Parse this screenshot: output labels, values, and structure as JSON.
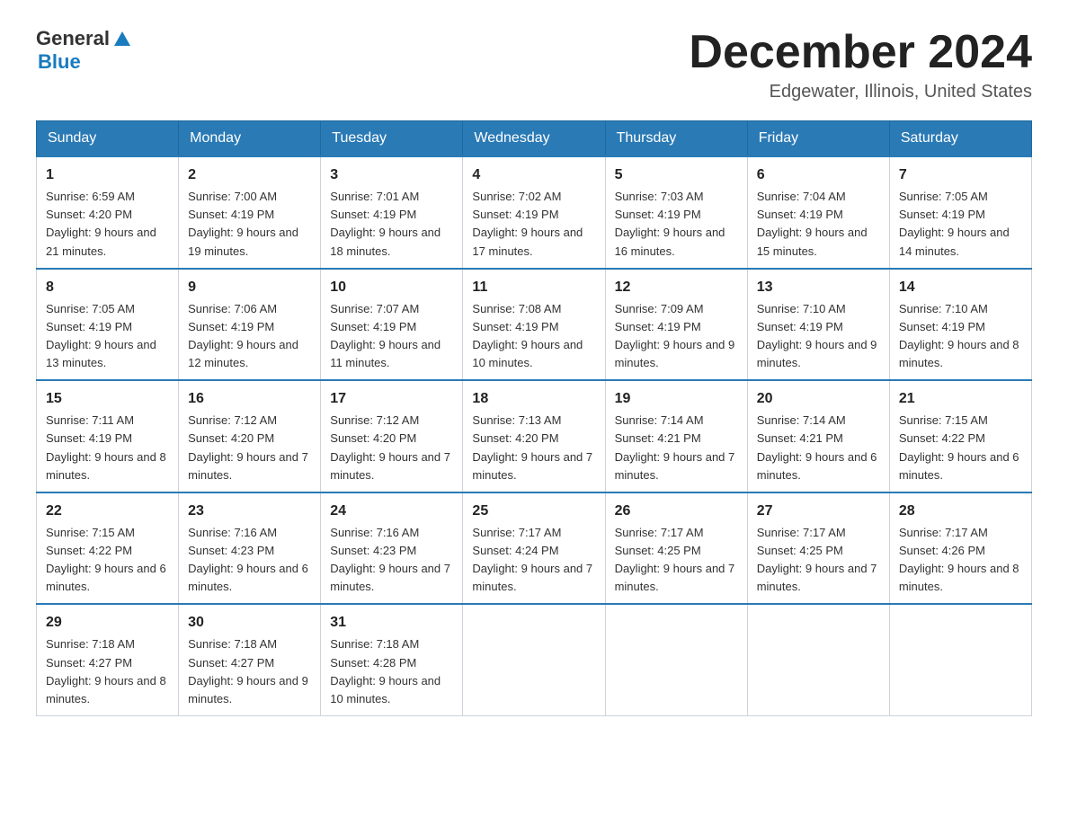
{
  "header": {
    "logo_general": "General",
    "logo_blue": "Blue",
    "month_title": "December 2024",
    "location": "Edgewater, Illinois, United States"
  },
  "weekdays": [
    "Sunday",
    "Monday",
    "Tuesday",
    "Wednesday",
    "Thursday",
    "Friday",
    "Saturday"
  ],
  "weeks": [
    [
      {
        "day": "1",
        "sunrise": "Sunrise: 6:59 AM",
        "sunset": "Sunset: 4:20 PM",
        "daylight": "Daylight: 9 hours and 21 minutes."
      },
      {
        "day": "2",
        "sunrise": "Sunrise: 7:00 AM",
        "sunset": "Sunset: 4:19 PM",
        "daylight": "Daylight: 9 hours and 19 minutes."
      },
      {
        "day": "3",
        "sunrise": "Sunrise: 7:01 AM",
        "sunset": "Sunset: 4:19 PM",
        "daylight": "Daylight: 9 hours and 18 minutes."
      },
      {
        "day": "4",
        "sunrise": "Sunrise: 7:02 AM",
        "sunset": "Sunset: 4:19 PM",
        "daylight": "Daylight: 9 hours and 17 minutes."
      },
      {
        "day": "5",
        "sunrise": "Sunrise: 7:03 AM",
        "sunset": "Sunset: 4:19 PM",
        "daylight": "Daylight: 9 hours and 16 minutes."
      },
      {
        "day": "6",
        "sunrise": "Sunrise: 7:04 AM",
        "sunset": "Sunset: 4:19 PM",
        "daylight": "Daylight: 9 hours and 15 minutes."
      },
      {
        "day": "7",
        "sunrise": "Sunrise: 7:05 AM",
        "sunset": "Sunset: 4:19 PM",
        "daylight": "Daylight: 9 hours and 14 minutes."
      }
    ],
    [
      {
        "day": "8",
        "sunrise": "Sunrise: 7:05 AM",
        "sunset": "Sunset: 4:19 PM",
        "daylight": "Daylight: 9 hours and 13 minutes."
      },
      {
        "day": "9",
        "sunrise": "Sunrise: 7:06 AM",
        "sunset": "Sunset: 4:19 PM",
        "daylight": "Daylight: 9 hours and 12 minutes."
      },
      {
        "day": "10",
        "sunrise": "Sunrise: 7:07 AM",
        "sunset": "Sunset: 4:19 PM",
        "daylight": "Daylight: 9 hours and 11 minutes."
      },
      {
        "day": "11",
        "sunrise": "Sunrise: 7:08 AM",
        "sunset": "Sunset: 4:19 PM",
        "daylight": "Daylight: 9 hours and 10 minutes."
      },
      {
        "day": "12",
        "sunrise": "Sunrise: 7:09 AM",
        "sunset": "Sunset: 4:19 PM",
        "daylight": "Daylight: 9 hours and 9 minutes."
      },
      {
        "day": "13",
        "sunrise": "Sunrise: 7:10 AM",
        "sunset": "Sunset: 4:19 PM",
        "daylight": "Daylight: 9 hours and 9 minutes."
      },
      {
        "day": "14",
        "sunrise": "Sunrise: 7:10 AM",
        "sunset": "Sunset: 4:19 PM",
        "daylight": "Daylight: 9 hours and 8 minutes."
      }
    ],
    [
      {
        "day": "15",
        "sunrise": "Sunrise: 7:11 AM",
        "sunset": "Sunset: 4:19 PM",
        "daylight": "Daylight: 9 hours and 8 minutes."
      },
      {
        "day": "16",
        "sunrise": "Sunrise: 7:12 AM",
        "sunset": "Sunset: 4:20 PM",
        "daylight": "Daylight: 9 hours and 7 minutes."
      },
      {
        "day": "17",
        "sunrise": "Sunrise: 7:12 AM",
        "sunset": "Sunset: 4:20 PM",
        "daylight": "Daylight: 9 hours and 7 minutes."
      },
      {
        "day": "18",
        "sunrise": "Sunrise: 7:13 AM",
        "sunset": "Sunset: 4:20 PM",
        "daylight": "Daylight: 9 hours and 7 minutes."
      },
      {
        "day": "19",
        "sunrise": "Sunrise: 7:14 AM",
        "sunset": "Sunset: 4:21 PM",
        "daylight": "Daylight: 9 hours and 7 minutes."
      },
      {
        "day": "20",
        "sunrise": "Sunrise: 7:14 AM",
        "sunset": "Sunset: 4:21 PM",
        "daylight": "Daylight: 9 hours and 6 minutes."
      },
      {
        "day": "21",
        "sunrise": "Sunrise: 7:15 AM",
        "sunset": "Sunset: 4:22 PM",
        "daylight": "Daylight: 9 hours and 6 minutes."
      }
    ],
    [
      {
        "day": "22",
        "sunrise": "Sunrise: 7:15 AM",
        "sunset": "Sunset: 4:22 PM",
        "daylight": "Daylight: 9 hours and 6 minutes."
      },
      {
        "day": "23",
        "sunrise": "Sunrise: 7:16 AM",
        "sunset": "Sunset: 4:23 PM",
        "daylight": "Daylight: 9 hours and 6 minutes."
      },
      {
        "day": "24",
        "sunrise": "Sunrise: 7:16 AM",
        "sunset": "Sunset: 4:23 PM",
        "daylight": "Daylight: 9 hours and 7 minutes."
      },
      {
        "day": "25",
        "sunrise": "Sunrise: 7:17 AM",
        "sunset": "Sunset: 4:24 PM",
        "daylight": "Daylight: 9 hours and 7 minutes."
      },
      {
        "day": "26",
        "sunrise": "Sunrise: 7:17 AM",
        "sunset": "Sunset: 4:25 PM",
        "daylight": "Daylight: 9 hours and 7 minutes."
      },
      {
        "day": "27",
        "sunrise": "Sunrise: 7:17 AM",
        "sunset": "Sunset: 4:25 PM",
        "daylight": "Daylight: 9 hours and 7 minutes."
      },
      {
        "day": "28",
        "sunrise": "Sunrise: 7:17 AM",
        "sunset": "Sunset: 4:26 PM",
        "daylight": "Daylight: 9 hours and 8 minutes."
      }
    ],
    [
      {
        "day": "29",
        "sunrise": "Sunrise: 7:18 AM",
        "sunset": "Sunset: 4:27 PM",
        "daylight": "Daylight: 9 hours and 8 minutes."
      },
      {
        "day": "30",
        "sunrise": "Sunrise: 7:18 AM",
        "sunset": "Sunset: 4:27 PM",
        "daylight": "Daylight: 9 hours and 9 minutes."
      },
      {
        "day": "31",
        "sunrise": "Sunrise: 7:18 AM",
        "sunset": "Sunset: 4:28 PM",
        "daylight": "Daylight: 9 hours and 10 minutes."
      },
      {
        "day": "",
        "sunrise": "",
        "sunset": "",
        "daylight": ""
      },
      {
        "day": "",
        "sunrise": "",
        "sunset": "",
        "daylight": ""
      },
      {
        "day": "",
        "sunrise": "",
        "sunset": "",
        "daylight": ""
      },
      {
        "day": "",
        "sunrise": "",
        "sunset": "",
        "daylight": ""
      }
    ]
  ]
}
